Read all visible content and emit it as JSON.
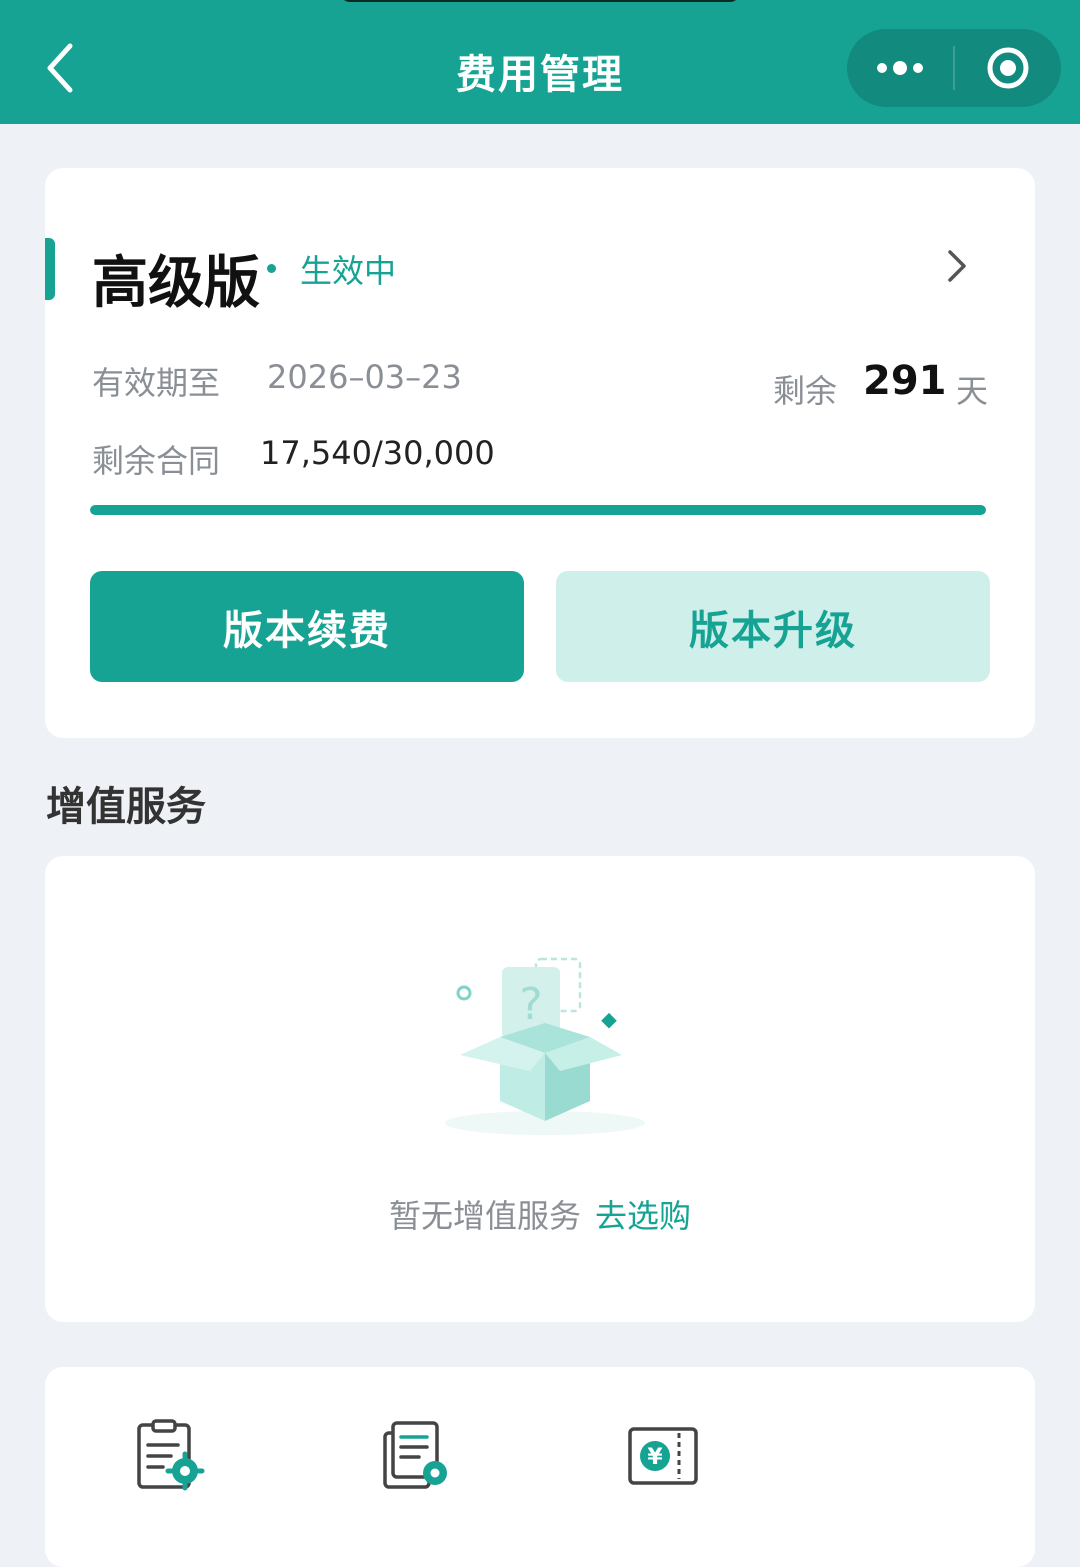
{
  "header": {
    "title": "费用管理",
    "back_icon": "chevron-left-icon",
    "menu_icon": "more-dots-icon",
    "close_icon": "target-circle-icon"
  },
  "plan": {
    "name": "高级版",
    "status": "生效中",
    "expiry_label": "有效期至",
    "expiry_value": "2026–03–23",
    "remaining_label": "剩余",
    "remaining_days": "291",
    "remaining_unit": "天",
    "contract_label": "剩余合同",
    "contract_value": "17,540/30,000",
    "progress_fraction": 1.0,
    "renew_button": "版本续费",
    "upgrade_button": "版本升级"
  },
  "value_added": {
    "section_title": "增值服务",
    "empty_text": "暂无增值服务",
    "link_text": "去选购",
    "illustration_icon": "empty-box-icon"
  },
  "tools": [
    {
      "icon": "clipboard-gear-icon"
    },
    {
      "icon": "document-stack-gear-icon"
    },
    {
      "icon": "yuan-ticket-icon"
    }
  ],
  "colors": {
    "accent": "#16a394",
    "accent_light": "#cfefeb",
    "background": "#eef1f5"
  }
}
